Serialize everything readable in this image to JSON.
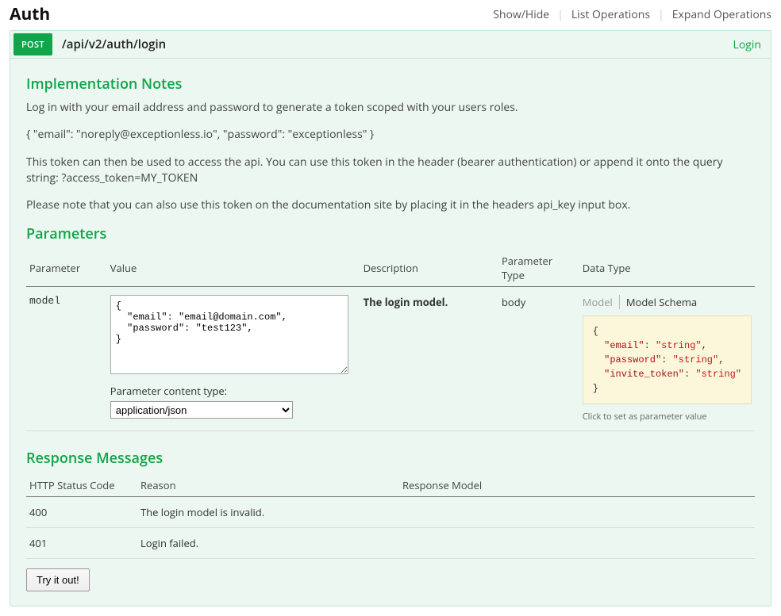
{
  "section": {
    "title": "Auth",
    "links": {
      "show_hide": "Show/Hide",
      "list_ops": "List Operations",
      "expand_ops": "Expand Operations"
    }
  },
  "operation": {
    "method": "POST",
    "path": "/api/v2/auth/login",
    "name": "Login",
    "notes_heading": "Implementation Notes",
    "notes": [
      "Log in with your email address and password to generate a token scoped with your users roles.",
      "{ \"email\": \"noreply@exceptionless.io\", \"password\": \"exceptionless\" }",
      "This token can then be used to access the api. You can use this token in the header (bearer authentication) or append it onto the query string: ?access_token=MY_TOKEN",
      "Please note that you can also use this token on the documentation site by placing it in the headers api_key input box."
    ]
  },
  "parameters": {
    "heading": "Parameters",
    "columns": {
      "parameter": "Parameter",
      "value": "Value",
      "description": "Description",
      "param_type": "Parameter Type",
      "data_type": "Data Type"
    },
    "rows": [
      {
        "name": "model",
        "value": "{\n  \"email\": \"email@domain.com\",\n  \"password\": \"test123\",\n}",
        "content_type_label": "Parameter content type:",
        "content_type_value": "application/json",
        "description": "The login model.",
        "param_type": "body",
        "data_type": {
          "tabs": {
            "model": "Model",
            "schema": "Model Schema"
          },
          "schema": "{\n  \"email\": \"string\",\n  \"password\": \"string\",\n  \"invite_token\": \"string\"\n}",
          "hint": "Click to set as parameter value"
        }
      }
    ]
  },
  "response_messages": {
    "heading": "Response Messages",
    "columns": {
      "code": "HTTP Status Code",
      "reason": "Reason",
      "model": "Response Model"
    },
    "rows": [
      {
        "code": "400",
        "reason": "The login model is invalid."
      },
      {
        "code": "401",
        "reason": "Login failed."
      }
    ]
  },
  "try_button": "Try it out!"
}
